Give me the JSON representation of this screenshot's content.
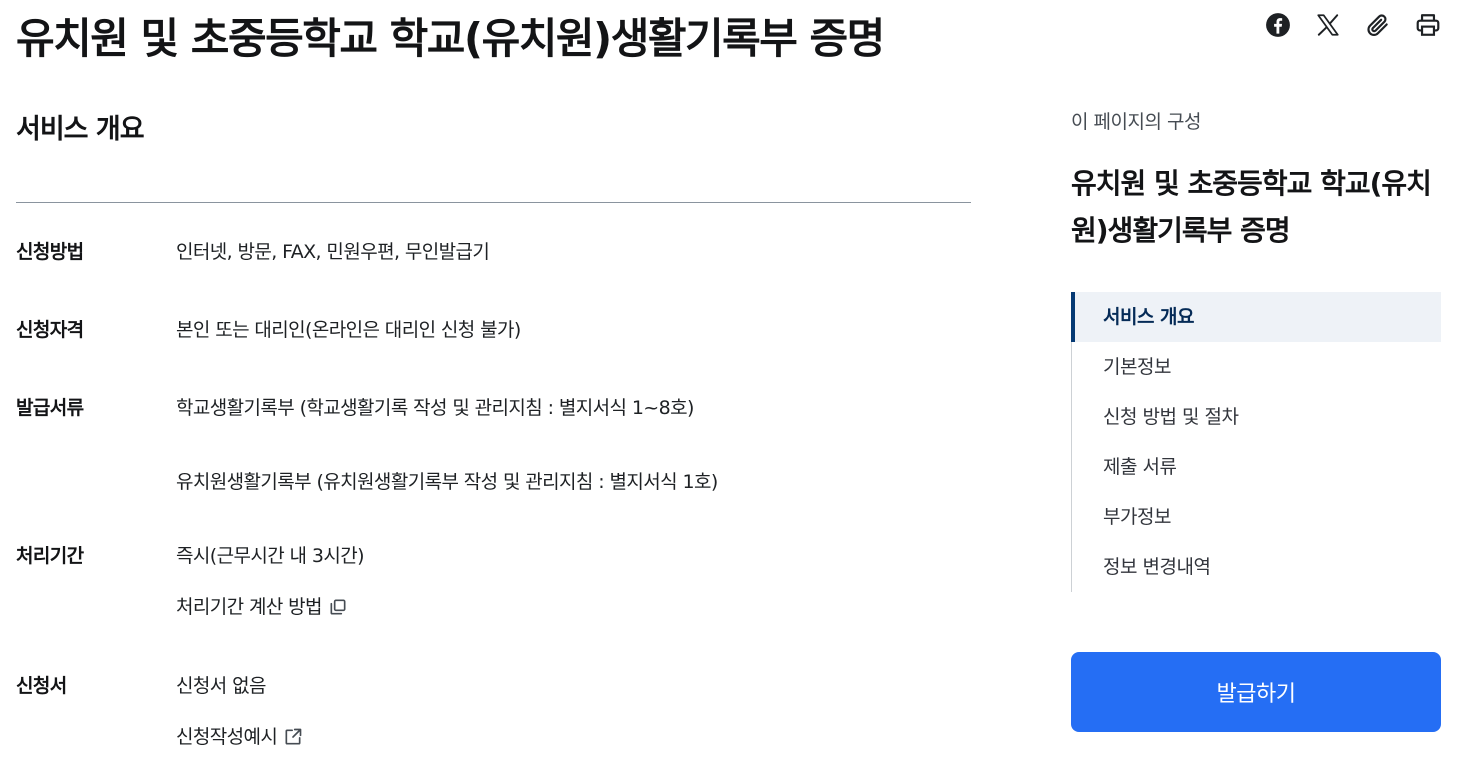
{
  "header": {
    "title": "유치원 및 초중등학교 학교(유치원)생활기록부 증명",
    "share_icons": [
      "facebook-icon",
      "x-icon",
      "paperclip-icon",
      "printer-icon"
    ]
  },
  "main": {
    "section_title": "서비스 개요",
    "rows": {
      "method": {
        "label": "신청방법",
        "value": "인터넷, 방문, FAX, 민원우편, 무인발급기"
      },
      "qualification": {
        "label": "신청자격",
        "value": "본인 또는 대리인(온라인은 대리인 신청 불가)"
      },
      "documents": {
        "label": "발급서류",
        "values": [
          "학교생활기록부 (학교생활기록 작성 및 관리지침 : 별지서식 1~8호)",
          "유치원생활기록부 (유치원생활기록부 작성 및 관리지침 : 별지서식 1호)"
        ]
      },
      "period": {
        "label": "처리기간",
        "value": "즉시(근무시간 내 3시간)",
        "link": "처리기간 계산 방법"
      },
      "form": {
        "label": "신청서",
        "value": "신청서 없음",
        "link": "신청작성예시"
      }
    }
  },
  "sidebar": {
    "caption": "이 페이지의 구성",
    "title": "유치원 및 초중등학교 학교(유치원)생활기록부 증명",
    "toc": [
      "서비스 개요",
      "기본정보",
      "신청 방법 및 절차",
      "제출 서류",
      "부가정보",
      "정보 변경내역"
    ],
    "active_index": 0
  },
  "cta": {
    "label": "발급하기"
  },
  "colors": {
    "accent": "#256ef4",
    "toc_active_bar": "#063a74",
    "toc_active_bg": "#eef2f7"
  }
}
